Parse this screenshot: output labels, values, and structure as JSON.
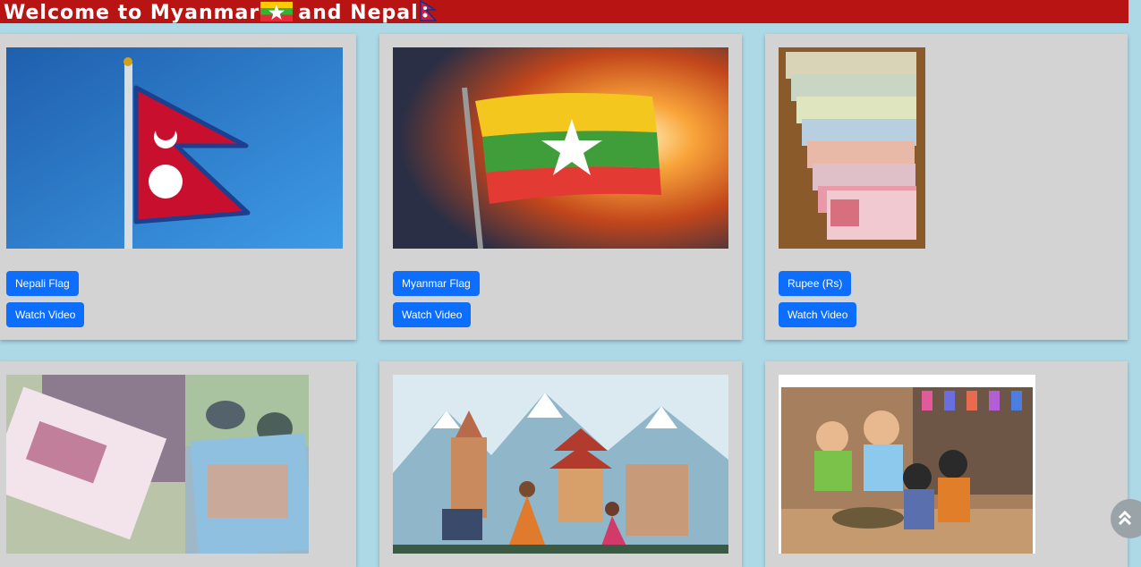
{
  "header": {
    "title_part1": "Welcome to Myanmar",
    "title_part2": "and Nepal",
    "flag_myanmar": "myanmar-flag-icon",
    "flag_nepal": "nepal-flag-icon"
  },
  "cards": [
    {
      "image": "nepali-flag-photo",
      "label_button": "Nepali Flag",
      "video_button": "Watch Video"
    },
    {
      "image": "myanmar-flag-photo",
      "label_button": "Myanmar Flag",
      "video_button": "Watch Video"
    },
    {
      "image": "nepali-rupee-notes-photo",
      "label_button": "Rupee (Rs)",
      "video_button": "Watch Video"
    },
    {
      "image": "myanmar-kyat-notes-photo"
    },
    {
      "image": "nepal-culture-illustration"
    },
    {
      "image": "myanmar-family-illustration"
    }
  ],
  "scroll_top": {
    "icon": "double-chevron-up-icon",
    "glyph": "⌃"
  },
  "colors": {
    "header_bg": "#b81414",
    "page_bg": "#add8e6",
    "card_bg": "#d3d3d3",
    "button_bg": "#0d6efd"
  }
}
